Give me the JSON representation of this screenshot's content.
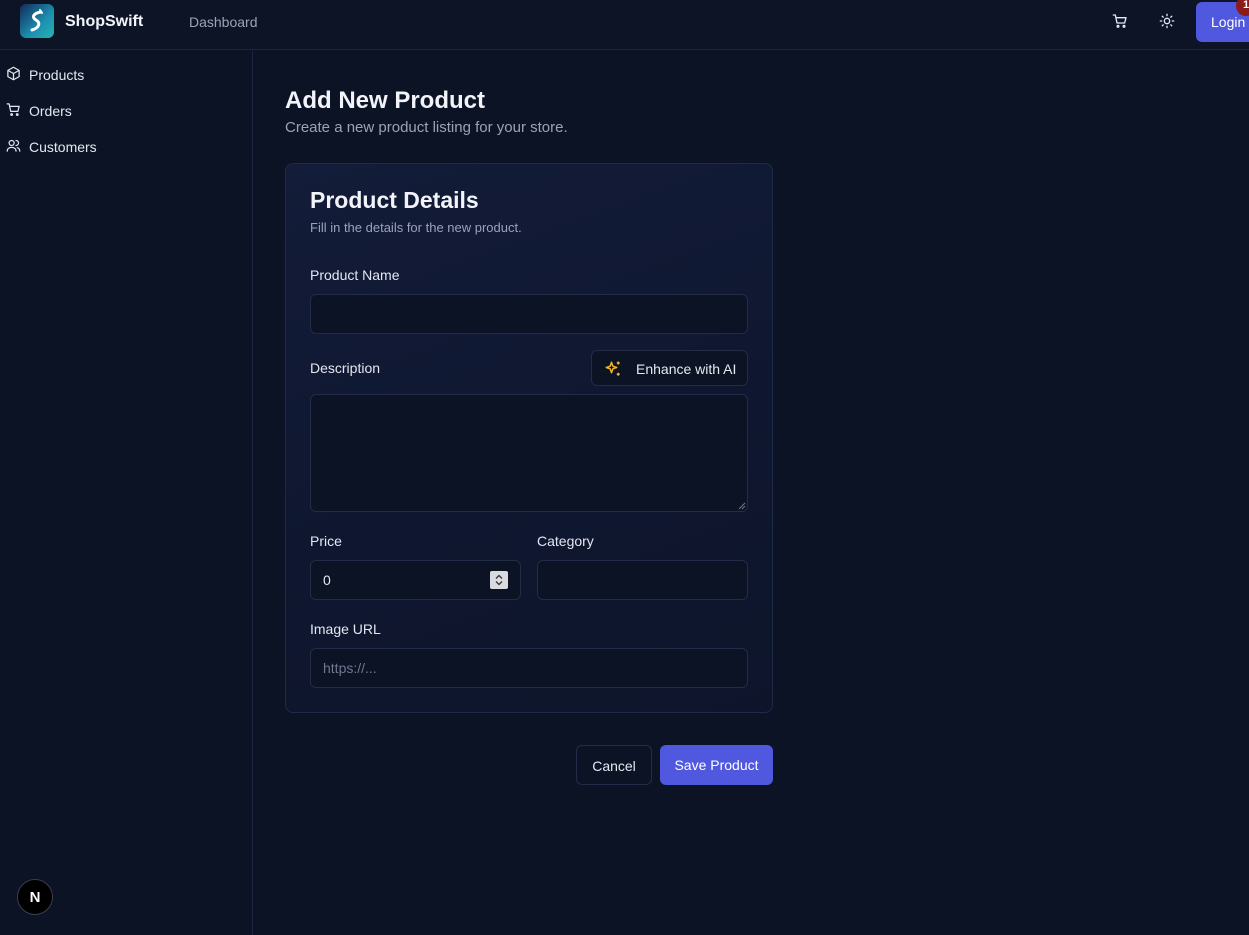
{
  "app": {
    "brand": "ShopSwift",
    "nav_dashboard": "Dashboard",
    "login_label": "Login",
    "login_badge": "1",
    "accent_color": "#5058e0"
  },
  "sidebar": {
    "items": [
      {
        "label": "Products",
        "icon": "package-icon"
      },
      {
        "label": "Orders",
        "icon": "cart-icon"
      },
      {
        "label": "Customers",
        "icon": "users-icon"
      }
    ],
    "dev_badge": "N"
  },
  "page": {
    "title": "Add New Product",
    "subtitle": "Create a new product listing for your store."
  },
  "form": {
    "title": "Product Details",
    "subtitle": "Fill in the details for the new product.",
    "product_name": {
      "label": "Product Name",
      "value": "",
      "placeholder": ""
    },
    "description": {
      "label": "Description",
      "value": "",
      "placeholder": ""
    },
    "enhance_ai_label": "Enhance with AI",
    "price": {
      "label": "Price",
      "value": "0"
    },
    "category": {
      "label": "Category",
      "value": "",
      "placeholder": ""
    },
    "image_url": {
      "label": "Image URL",
      "value": "",
      "placeholder": "https://..."
    }
  },
  "actions": {
    "cancel_label": "Cancel",
    "save_label": "Save Product"
  }
}
